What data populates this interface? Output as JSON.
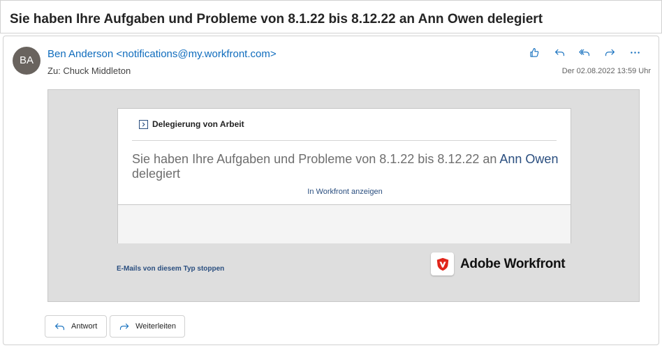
{
  "subject": "Sie haben Ihre Aufgaben und Probleme von 8.1.22 bis 8.12.22 an Ann Owen delegiert",
  "sender": {
    "avatar_initials": "BA",
    "avatar_color": "#69635e",
    "name": "Ben Anderson",
    "email": "<notifications@my.workfront.com>"
  },
  "recipients": "Zu: Chuck Middleton",
  "date": "Der 02.08.2022 13:59 Uhr",
  "actions": [
    "like-icon",
    "reply-icon",
    "reply-all-icon",
    "forward-icon",
    "more-icon"
  ],
  "body": {
    "card_header": "Delegierung von Arbeit",
    "headline_part1": "Sie haben Ihre Aufgaben und Probleme von 8.1.22 bis 8.12.22 an ",
    "headline_name": "Ann Owen",
    "headline_part2": " delegiert",
    "view_link": "In Workfront anzeigen",
    "stop_link": "E-Mails von diesem Typ stoppen",
    "brand": "Adobe Workfront"
  },
  "buttons": {
    "reply": "Antwort",
    "forward": "Weiterleiten"
  },
  "colors": {
    "accent": "#0f6cbd",
    "link": "#2a4e7f",
    "brand_red": "#e0251b"
  }
}
